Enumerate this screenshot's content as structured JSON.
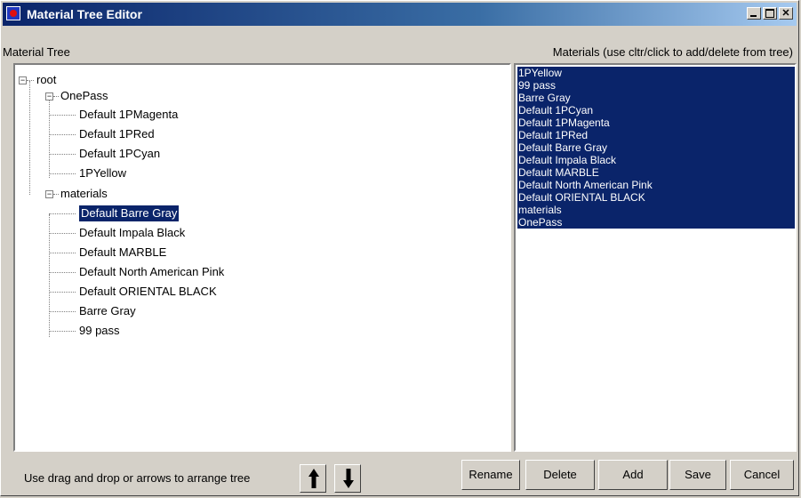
{
  "window": {
    "title": "Material Tree Editor"
  },
  "headers": {
    "tree": "Material Tree",
    "materials": "Materials (use cltr/click to add/delete from tree)"
  },
  "tree": {
    "root": "root",
    "groups": [
      {
        "label": "OnePass",
        "children": [
          "Default 1PMagenta",
          "Default 1PRed",
          "Default 1PCyan",
          "1PYellow"
        ]
      },
      {
        "label": "materials",
        "children": [
          "Default Barre Gray",
          "Default Impala Black",
          "Default MARBLE",
          "Default North American Pink",
          "Default ORIENTAL BLACK",
          "Barre Gray",
          "99 pass"
        ]
      }
    ],
    "selected": "Default Barre Gray"
  },
  "materials_list": [
    "1PYellow",
    "99 pass",
    "Barre Gray",
    "Default 1PCyan",
    "Default 1PMagenta",
    "Default 1PRed",
    "Default Barre Gray",
    "Default Impala Black",
    "Default MARBLE",
    "Default North American Pink",
    "Default ORIENTAL BLACK",
    "materials",
    "OnePass"
  ],
  "footer": {
    "instruction": "Use drag and drop or arrows to arrange tree",
    "up_icon": "arrow-up-icon",
    "down_icon": "arrow-down-icon"
  },
  "buttons": {
    "rename": "Rename",
    "delete": "Delete",
    "add": "Add",
    "save": "Save",
    "cancel": "Cancel"
  },
  "colors": {
    "selection": "#0a246a",
    "face": "#d4d0c8"
  }
}
